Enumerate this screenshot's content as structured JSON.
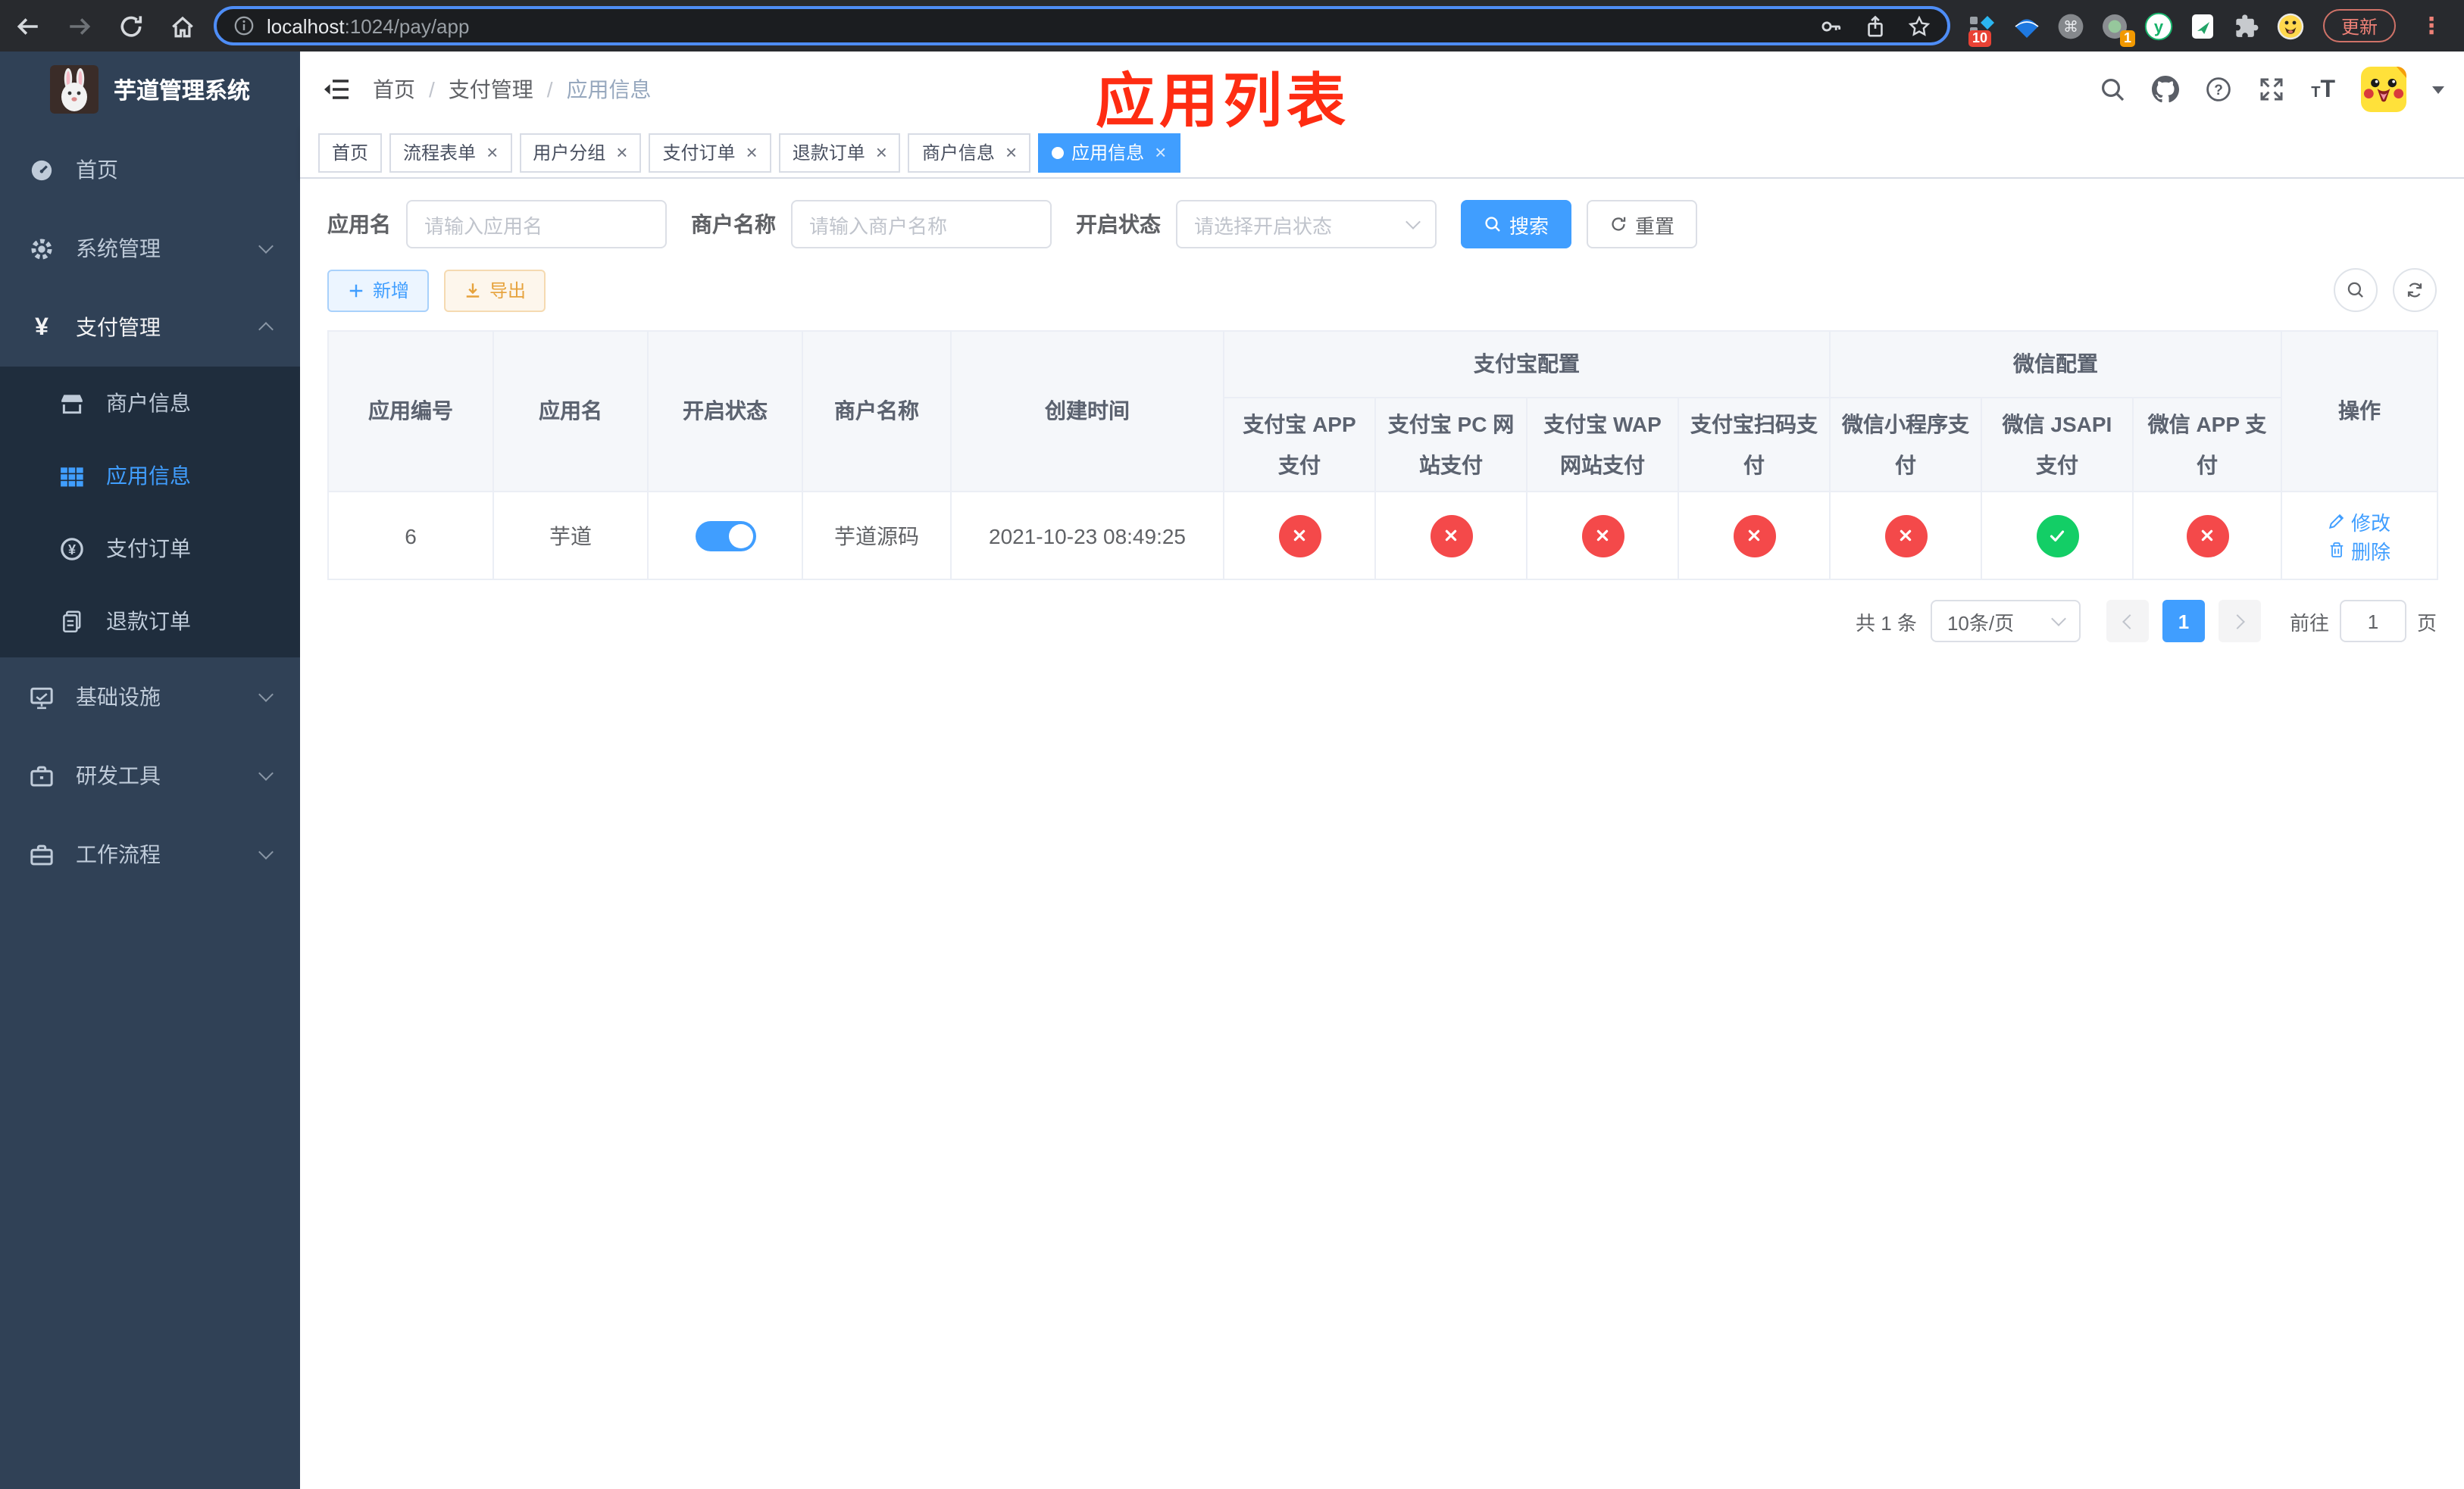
{
  "browser": {
    "url_host": "localhost",
    "url_path": ":1024/pay/app",
    "update_button": "更新",
    "ext_badge_blue": "10",
    "ext_badge_circle": "1"
  },
  "sidebar": {
    "title": "芋道管理系统",
    "menu": [
      {
        "label": "首页",
        "icon": "dashboard",
        "level": 1
      },
      {
        "label": "系统管理",
        "icon": "gear",
        "level": 1,
        "chevron": "down"
      },
      {
        "label": "支付管理",
        "icon": "yen",
        "level": 1,
        "chevron": "up",
        "open": true
      },
      {
        "label": "商户信息",
        "icon": "shop",
        "level": 2
      },
      {
        "label": "应用信息",
        "icon": "grid",
        "level": 2,
        "active": true
      },
      {
        "label": "支付订单",
        "icon": "coin",
        "level": 2
      },
      {
        "label": "退款订单",
        "icon": "doc",
        "level": 2
      },
      {
        "label": "基础设施",
        "icon": "monitor",
        "level": 1,
        "chevron": "down"
      },
      {
        "label": "研发工具",
        "icon": "briefcase",
        "level": 1,
        "chevron": "down"
      },
      {
        "label": "工作流程",
        "icon": "toolbox",
        "level": 1,
        "chevron": "down"
      }
    ]
  },
  "navbar": {
    "breadcrumb": [
      "首页",
      "支付管理",
      "应用信息"
    ],
    "annotation": "应用列表"
  },
  "tags": [
    {
      "label": "首页",
      "closable": false,
      "active": false
    },
    {
      "label": "流程表单",
      "closable": true,
      "active": false
    },
    {
      "label": "用户分组",
      "closable": true,
      "active": false
    },
    {
      "label": "支付订单",
      "closable": true,
      "active": false
    },
    {
      "label": "退款订单",
      "closable": true,
      "active": false
    },
    {
      "label": "商户信息",
      "closable": true,
      "active": false
    },
    {
      "label": "应用信息",
      "closable": true,
      "active": true
    }
  ],
  "filters": {
    "app_name_label": "应用名",
    "app_name_placeholder": "请输入应用名",
    "merchant_label": "商户名称",
    "merchant_placeholder": "请输入商户名称",
    "status_label": "开启状态",
    "status_placeholder": "请选择开启状态",
    "search_button": "搜索",
    "reset_button": "重置"
  },
  "toolbar": {
    "add_button": "新增",
    "export_button": "导出"
  },
  "table": {
    "headers": {
      "app_id": "应用编号",
      "app_name": "应用名",
      "status": "开启状态",
      "merchant": "商户名称",
      "created": "创建时间",
      "alipay_group": "支付宝配置",
      "wechat_group": "微信配置",
      "actions": "操作",
      "pay_methods": [
        "支付宝 APP 支付",
        "支付宝 PC 网站支付",
        "支付宝 WAP 网站支付",
        "支付宝扫码支付",
        "微信小程序支付",
        "微信 JSAPI 支付",
        "微信 APP 支付"
      ]
    },
    "row": {
      "app_id": "6",
      "app_name": "芋道",
      "status_on": true,
      "merchant": "芋道源码",
      "created": "2021-10-23 08:49:25",
      "pay_status": [
        false,
        false,
        false,
        false,
        false,
        true,
        false
      ],
      "edit": "修改",
      "delete": "删除"
    }
  },
  "pagination": {
    "total": "共 1 条",
    "page_size": "10条/页",
    "page": "1",
    "goto_label": "前往",
    "goto_value": "1",
    "page_unit": "页"
  },
  "colors": {
    "primary": "#409eff",
    "success": "#13ce66",
    "danger": "#f4494a",
    "warning": "#e6a23c",
    "annotation": "#fe2c12",
    "sidebar_bg": "#304156",
    "submenu_bg": "#1f2d3d"
  }
}
